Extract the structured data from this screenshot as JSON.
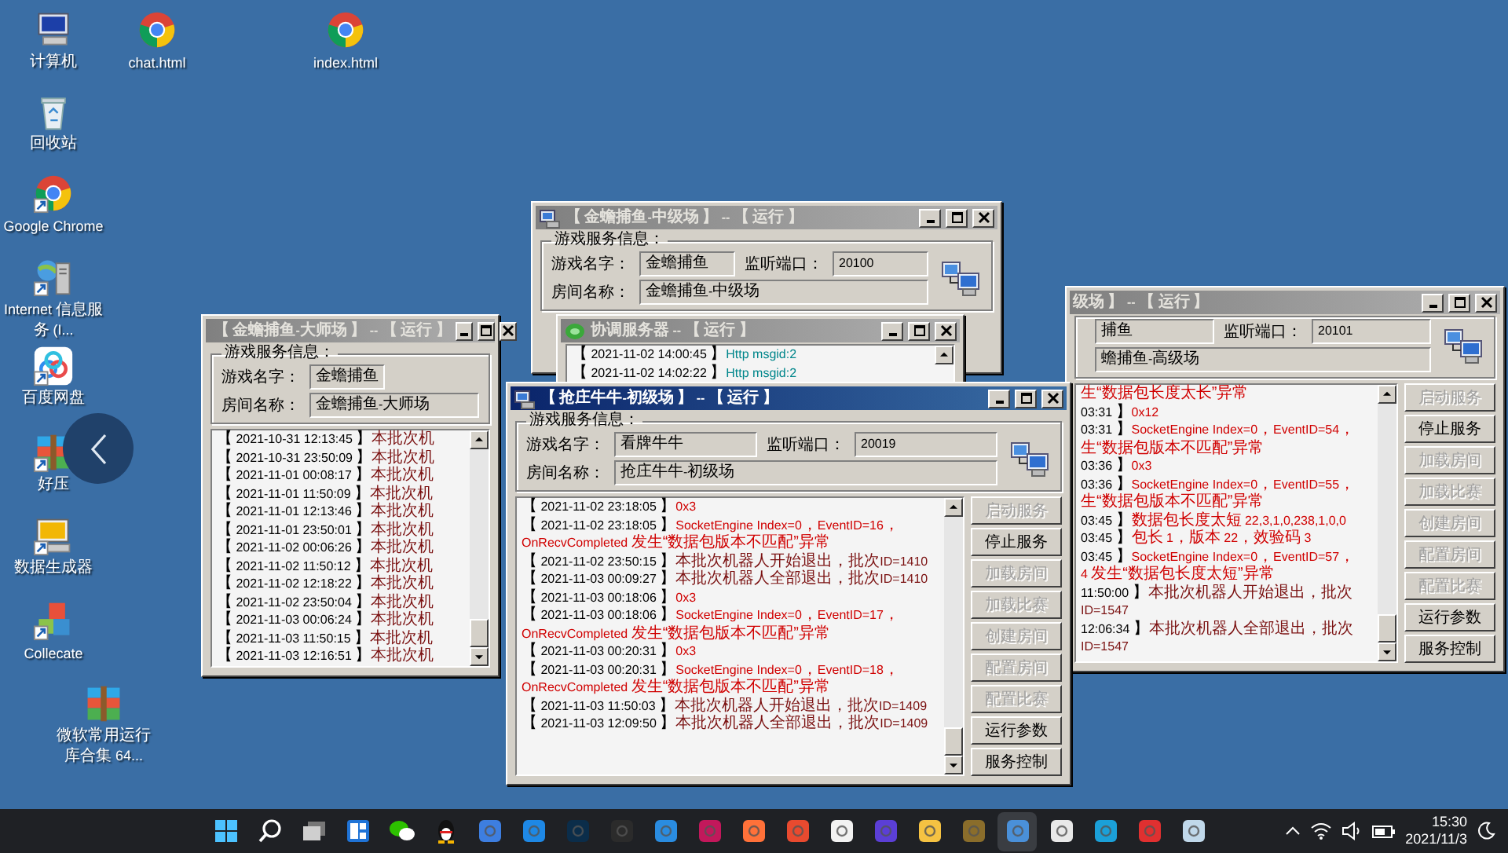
{
  "desktop_icons": [
    {
      "label": "计算机",
      "kind": "computer",
      "shortcut": false
    },
    {
      "label": "chat.html",
      "kind": "browser",
      "shortcut": false
    },
    {
      "label": "index.html",
      "kind": "browser",
      "shortcut": false
    },
    {
      "label": "回收站",
      "kind": "trash",
      "shortcut": false
    },
    {
      "label": "Google Chrome",
      "kind": "browser",
      "shortcut": true
    },
    {
      "label": "Internet 信息服务 (I...",
      "kind": "server",
      "shortcut": true
    },
    {
      "label": "百度网盘",
      "kind": "cloud",
      "shortcut": true
    },
    {
      "label": "好压",
      "kind": "archive",
      "shortcut": true
    },
    {
      "label": "数据生成器",
      "kind": "monitor",
      "shortcut": true
    },
    {
      "label": "Collecate",
      "kind": "cubes",
      "shortcut": true
    },
    {
      "label": "微软常用运行库合集 64...",
      "kind": "archive",
      "shortcut": false
    }
  ],
  "windows": [
    {
      "title": "【 金蟾捕鱼-大师场 】 -- 【 运行 】",
      "active": false,
      "group_label": "游戏服务信息：",
      "server_icon": false,
      "fields": [
        {
          "kind": "name",
          "label": "游戏名字：",
          "value": "金蟾捕鱼"
        },
        {
          "kind": "room",
          "label": "房间名称：",
          "value": "金蟾捕鱼-大师场"
        }
      ],
      "log": [
        {
          "time": "【 2021-10-31 12:13:45 】",
          "message": "本批次机",
          "kind": "notice"
        },
        {
          "time": "【 2021-10-31 23:50:09 】",
          "message": "本批次机",
          "kind": "notice"
        },
        {
          "time": "【 2021-11-01 00:08:17 】",
          "message": "本批次机",
          "kind": "notice"
        },
        {
          "time": "【 2021-11-01 11:50:09 】",
          "message": "本批次机",
          "kind": "notice"
        },
        {
          "time": "【 2021-11-01 12:13:46 】",
          "message": "本批次机",
          "kind": "notice"
        },
        {
          "time": "【 2021-11-01 23:50:01 】",
          "message": "本批次机",
          "kind": "notice"
        },
        {
          "time": "【 2021-11-02 00:06:26 】",
          "message": "本批次机",
          "kind": "notice"
        },
        {
          "time": "【 2021-11-02 11:50:12 】",
          "message": "本批次机",
          "kind": "notice"
        },
        {
          "time": "【 2021-11-02 12:18:22 】",
          "message": "本批次机",
          "kind": "notice"
        },
        {
          "time": "【 2021-11-02 23:50:04 】",
          "message": "本批次机",
          "kind": "notice"
        },
        {
          "time": "【 2021-11-03 00:06:24 】",
          "message": "本批次机",
          "kind": "notice"
        },
        {
          "time": "【 2021-11-03 11:50:15 】",
          "message": "本批次机",
          "kind": "notice"
        },
        {
          "time": "【 2021-11-03 12:16:51 】",
          "message": "本批次机",
          "kind": "notice"
        }
      ]
    },
    {
      "title": "【 金蟾捕鱼-中级场 】 -- 【 运行 】",
      "active": false,
      "group_label": "游戏服务信息：",
      "server_icon": true,
      "fields": [
        {
          "kind": "name",
          "label": "游戏名字：",
          "value": "金蟾捕鱼"
        },
        {
          "kind": "port",
          "label": "监听端口：",
          "value": "20100"
        },
        {
          "kind": "room",
          "label": "房间名称：",
          "value": "金蟾捕鱼-中级场"
        }
      ]
    },
    {
      "title": "协调服务器 -- 【 运行 】",
      "active": false,
      "log": [
        {
          "time": "【 2021-11-02 14:00:45 】",
          "message": "Http msgid:2",
          "kind": "http"
        },
        {
          "time": "【 2021-11-02 14:02:22 】",
          "message": "Http msgid:2",
          "kind": "http"
        }
      ]
    },
    {
      "title": "【 抢庄牛牛-初级场 】 -- 【 运行 】",
      "active": true,
      "group_label": "游戏服务信息：",
      "server_icon": true,
      "fields": [
        {
          "kind": "name",
          "label": "游戏名字：",
          "value": "看牌牛牛"
        },
        {
          "kind": "port",
          "label": "监听端口：",
          "value": "20019"
        },
        {
          "kind": "room",
          "label": "房间名称：",
          "value": "抢庄牛牛-初级场"
        }
      ],
      "log": [
        {
          "time": "【 2021-11-02 23:18:05 】",
          "message": "0x3",
          "kind": "error"
        },
        {
          "time": "【 2021-11-02 23:18:05 】",
          "message": "SocketEngine Index=0，EventID=16，",
          "kind": "error"
        },
        {
          "message": "OnRecvCompleted 发生“数据包版本不匹配”异常",
          "kind": "error"
        },
        {
          "time": "【 2021-11-02 23:50:15 】",
          "message": "本批次机器人开始退出，批次ID=1410",
          "kind": "notice"
        },
        {
          "time": "【 2021-11-03 00:09:27 】",
          "message": "本批次机器人全部退出，批次ID=1410",
          "kind": "notice"
        },
        {
          "time": "【 2021-11-03 00:18:06 】",
          "message": "0x3",
          "kind": "error"
        },
        {
          "time": "【 2021-11-03 00:18:06 】",
          "message": "SocketEngine Index=0，EventID=17，",
          "kind": "error"
        },
        {
          "message": "OnRecvCompleted 发生“数据包版本不匹配”异常",
          "kind": "error"
        },
        {
          "time": "【 2021-11-03 00:20:31 】",
          "message": "0x3",
          "kind": "error"
        },
        {
          "time": "【 2021-11-03 00:20:31 】",
          "message": "SocketEngine Index=0，EventID=18，",
          "kind": "error"
        },
        {
          "message": "OnRecvCompleted 发生“数据包版本不匹配”异常",
          "kind": "error"
        },
        {
          "time": "【 2021-11-03 11:50:03 】",
          "message": "本批次机器人开始退出，批次ID=1409",
          "kind": "notice"
        },
        {
          "time": "【 2021-11-03 12:09:50 】",
          "message": "本批次机器人全部退出，批次ID=1409",
          "kind": "notice"
        }
      ],
      "buttons": [
        {
          "label": "启动服务",
          "disabled": true
        },
        {
          "label": "停止服务",
          "disabled": false
        },
        {
          "label": "加载房间",
          "disabled": true
        },
        {
          "label": "加载比赛",
          "disabled": true
        },
        {
          "label": "创建房间",
          "disabled": true
        },
        {
          "label": "配置房间",
          "disabled": true
        },
        {
          "label": "配置比赛",
          "disabled": true
        },
        {
          "label": "运行参数",
          "disabled": false
        },
        {
          "label": "服务控制",
          "disabled": false
        }
      ]
    },
    {
      "title": "级场 】 -- 【 运行 】",
      "active": false,
      "server_icon": true,
      "fields": [
        {
          "kind": "name",
          "value": "捕鱼"
        },
        {
          "kind": "port",
          "label": "监听端口：",
          "value": "20101"
        },
        {
          "kind": "room",
          "value": "蟾捕鱼-高级场"
        }
      ],
      "log": [
        {
          "message": "生“数据包长度太长”异常",
          "kind": "error"
        },
        {
          "time": "03:31 】",
          "message": "0x12",
          "kind": "error"
        },
        {
          "time": "03:31 】",
          "message": "SocketEngine Index=0，EventID=54，",
          "kind": "error"
        },
        {
          "message": "生“数据包版本不匹配”异常",
          "kind": "error"
        },
        {
          "time": "03:36 】",
          "message": "0x3",
          "kind": "error"
        },
        {
          "time": "03:36 】",
          "message": "SocketEngine Index=0，EventID=55，",
          "kind": "error"
        },
        {
          "message": "生“数据包版本不匹配”异常",
          "kind": "error"
        },
        {
          "time": "03:45 】",
          "message": "数据包长度太短 22,3,1,0,238,1,0,0",
          "kind": "error"
        },
        {
          "time": "03:45 】",
          "message": "包长 1，版本 22，效验码 3",
          "kind": "error"
        },
        {
          "time": "03:45 】",
          "message": "SocketEngine Index=0，EventID=57，",
          "kind": "error"
        },
        {
          "message": "4 发生“数据包长度太短”异常",
          "kind": "error"
        },
        {
          "time": "11:50:00 】",
          "message": "本批次机器人开始退出，批次ID=1547",
          "kind": "notice"
        },
        {
          "time": "12:06:34 】",
          "message": "本批次机器人全部退出，批次ID=1547",
          "kind": "notice"
        }
      ],
      "buttons": [
        {
          "label": "启动服务",
          "disabled": true
        },
        {
          "label": "停止服务",
          "disabled": false
        },
        {
          "label": "加载房间",
          "disabled": true
        },
        {
          "label": "加载比赛",
          "disabled": true
        },
        {
          "label": "创建房间",
          "disabled": true
        },
        {
          "label": "配置房间",
          "disabled": true
        },
        {
          "label": "配置比赛",
          "disabled": true
        },
        {
          "label": "运行参数",
          "disabled": false
        },
        {
          "label": "服务控制",
          "disabled": false
        }
      ]
    }
  ],
  "taskbar": {
    "apps": [
      {
        "kind": "start",
        "selected": false
      },
      {
        "kind": "search",
        "selected": false
      },
      {
        "kind": "taskview",
        "selected": false
      },
      {
        "kind": "widgets",
        "selected": false
      },
      {
        "kind": "chat",
        "selected": false
      },
      {
        "kind": "penguin",
        "selected": false
      },
      {
        "kind": "tile",
        "color": "#3d7ee0",
        "selected": false
      },
      {
        "kind": "tile",
        "color": "#1e88e5",
        "selected": false
      },
      {
        "kind": "tile",
        "color": "#0b2d4a",
        "selected": false
      },
      {
        "kind": "tile",
        "color": "#2b2b2b",
        "selected": false
      },
      {
        "kind": "tile",
        "color": "#2a8ce0",
        "selected": false
      },
      {
        "kind": "tile",
        "color": "#c2185b",
        "selected": false
      },
      {
        "kind": "tile",
        "color": "#ff7139",
        "selected": false
      },
      {
        "kind": "tile",
        "color": "#e84a2f",
        "selected": false
      },
      {
        "kind": "tile",
        "color": "#f2f2f2",
        "selected": false
      },
      {
        "kind": "tile",
        "color": "#5b3fd6",
        "selected": false
      },
      {
        "kind": "tile",
        "color": "#f5c242",
        "selected": false
      },
      {
        "kind": "tile",
        "color": "#8a6d2b",
        "selected": false
      },
      {
        "kind": "tile",
        "color": "#4a90d9",
        "selected": true
      },
      {
        "kind": "tile",
        "color": "#e8e8e8",
        "selected": false
      },
      {
        "kind": "tile",
        "color": "#1ba0d8",
        "selected": false
      },
      {
        "kind": "tile",
        "color": "#e03030",
        "selected": false
      },
      {
        "kind": "tile",
        "color": "#c0d8ea",
        "selected": false
      }
    ],
    "time": "15:30",
    "date": "2021/11/3"
  }
}
